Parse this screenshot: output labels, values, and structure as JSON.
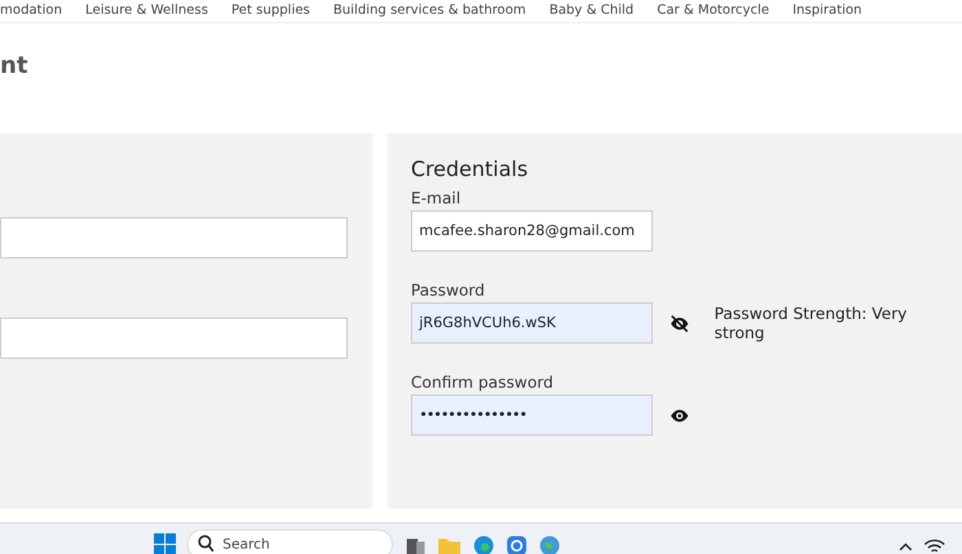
{
  "nav": {
    "items": [
      "modation",
      "Leisure & Wellness",
      "Pet supplies",
      "Building services & bathroom",
      "Baby & Child",
      "Car & Motorcycle",
      "Inspiration"
    ]
  },
  "page": {
    "title": "nt"
  },
  "left_panel": {
    "fields": [
      {
        "kind": "text"
      },
      {
        "kind": "text"
      }
    ]
  },
  "credentials": {
    "title": "Credentials",
    "fields": [
      {
        "label": "E-mail",
        "value": "mcafee.sharon28@gmail.com",
        "kind": "email",
        "autofilled": false
      },
      {
        "label": "Password",
        "value": "jR6G8hVCUh6.wSK",
        "kind": "password",
        "autofilled": true,
        "visible": true,
        "strength": "Password Strength: Very strong"
      },
      {
        "label": "Confirm password",
        "value": "•••••••••••••••",
        "kind": "password",
        "autofilled": true,
        "visible": false
      }
    ]
  },
  "taskbar": {
    "search": {
      "placeholder": "Search"
    }
  }
}
